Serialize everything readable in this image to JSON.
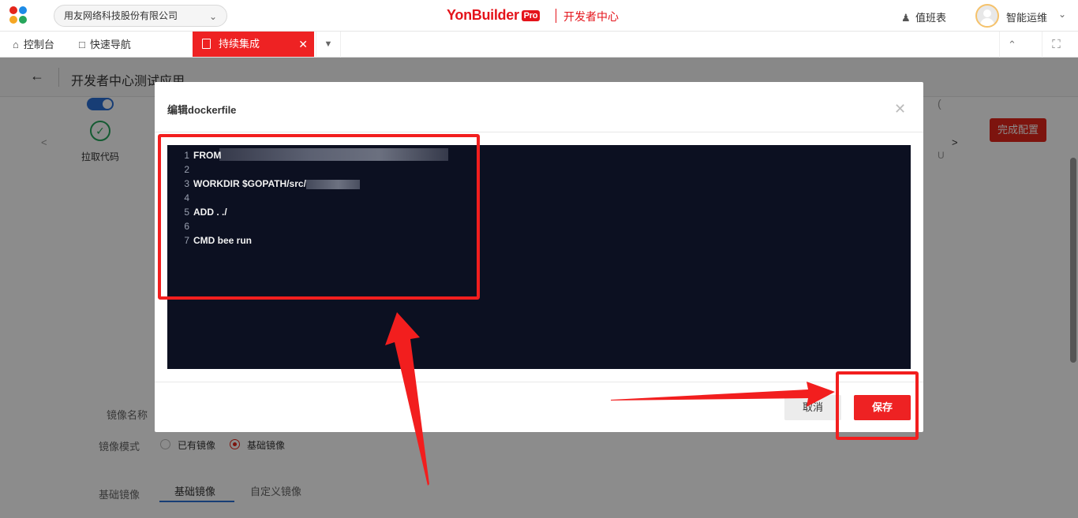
{
  "header": {
    "company": "用友网络科技股份有限公司",
    "brand_name": "YonBuilder",
    "brand_badge": "Pro",
    "brand_sub": "开发者中心",
    "duty_label": "值班表",
    "user_name": "智能运维"
  },
  "tabs": {
    "console": "控制台",
    "quick_nav": "快速导航",
    "active": "持续集成"
  },
  "page": {
    "title": "开发者中心测试应用",
    "step_label": "拉取代码",
    "finish_button": "完成配置",
    "image_name_label": "镜像名称",
    "image_mode_label": "镜像模式",
    "radio_existing": "已有镜像",
    "radio_base": "基础镜像",
    "base_image_label": "基础镜像",
    "subtab_base": "基础镜像",
    "subtab_custom": "自定义镜像"
  },
  "modal": {
    "title": "编辑dockerfile",
    "code_lines": [
      {
        "n": "1",
        "text": "FROM"
      },
      {
        "n": "2",
        "text": ""
      },
      {
        "n": "3",
        "text": "WORKDIR $GOPATH/src/"
      },
      {
        "n": "4",
        "text": ""
      },
      {
        "n": "5",
        "text": "ADD . ./"
      },
      {
        "n": "6",
        "text": ""
      },
      {
        "n": "7",
        "text": "CMD bee run"
      }
    ],
    "cancel_label": "取消",
    "save_label": "保存"
  },
  "colors": {
    "brand_red": "#e4131a",
    "editor_bg": "#0c1021",
    "annotation_red": "#f21e1e",
    "toggle_blue": "#2a6fd6",
    "success_green": "#26a65b"
  },
  "icons": {
    "logo": "colored-dots-logo",
    "company_chevron": "chevron-down-icon",
    "duty": "person-icon",
    "home": "home-icon",
    "monitor": "monitor-icon",
    "document": "document-icon",
    "close": "close-icon",
    "tab_more": "caret-down-icon",
    "collapse": "chevron-up-icon",
    "fullscreen": "fullscreen-icon",
    "back": "arrow-left-icon",
    "check": "check-circle-icon"
  }
}
